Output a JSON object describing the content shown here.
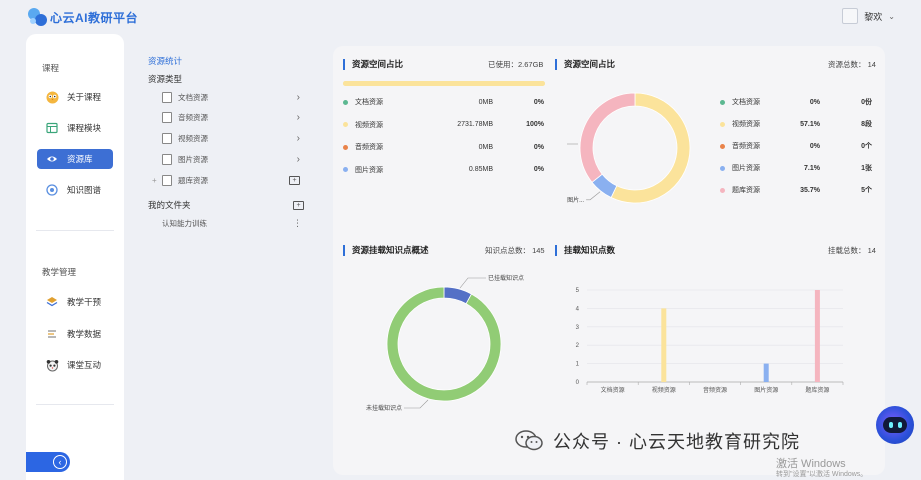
{
  "app": {
    "title": "心云AI教研平台"
  },
  "user": {
    "name": "黎欢"
  },
  "sidebar": {
    "section1": "课程",
    "items1": [
      {
        "label": "关于课程",
        "icon": "owl-icon"
      },
      {
        "label": "课程模块",
        "icon": "grid-icon"
      },
      {
        "label": "资源库",
        "icon": "eye-icon",
        "active": true
      },
      {
        "label": "知识图谱",
        "icon": "target-icon"
      }
    ],
    "section2": "教学管理",
    "items2": [
      {
        "label": "教学干预",
        "icon": "layers-icon"
      },
      {
        "label": "教学数据",
        "icon": "chart-icon"
      },
      {
        "label": "课堂互动",
        "icon": "panda-icon"
      }
    ]
  },
  "tree": {
    "stats_title": "资源统计",
    "types_title": "资源类型",
    "types": [
      "文档资源",
      "音频资源",
      "视频资源",
      "图片资源",
      "题库资源"
    ],
    "my_folders": "我的文件夹",
    "folders": [
      "认知能力训练"
    ]
  },
  "cards": {
    "space1": {
      "title": "资源空间占比",
      "meta": "已使用：2.67GB",
      "used_fraction": 1.0,
      "rows": [
        {
          "name": "文档资源",
          "size": "0MB",
          "pct": "0%",
          "color": "#5cb891"
        },
        {
          "name": "视频资源",
          "size": "2731.78MB",
          "pct": "100%",
          "color": "#fbe39b"
        },
        {
          "name": "音频资源",
          "size": "0MB",
          "pct": "0%",
          "color": "#e9834a"
        },
        {
          "name": "图片资源",
          "size": "0.85MB",
          "pct": "0%",
          "color": "#8ab0f0"
        }
      ]
    },
    "space2": {
      "title": "资源空间占比",
      "meta": "资源总数：  14",
      "callout": "图片...",
      "rows": [
        {
          "name": "文档资源",
          "pct": "0%",
          "count": "0份",
          "color": "#5cb891"
        },
        {
          "name": "视频资源",
          "pct": "57.1%",
          "count": "8段",
          "color": "#fbe39b"
        },
        {
          "name": "音频资源",
          "pct": "0%",
          "count": "0个",
          "color": "#e9834a"
        },
        {
          "name": "图片资源",
          "pct": "7.1%",
          "count": "1张",
          "color": "#8ab0f0"
        },
        {
          "name": "题库资源",
          "pct": "35.7%",
          "count": "5个",
          "color": "#f5b5bf"
        }
      ]
    },
    "knowledge": {
      "title": "资源挂载知识点概述",
      "meta": "知识点总数：  145",
      "labels": {
        "mounted": "已挂载知识点",
        "unmounted": "未挂载知识点"
      }
    },
    "mounted": {
      "title": "挂载知识点数",
      "meta": "挂载总数：  14"
    }
  },
  "chart_data": [
    {
      "type": "pie",
      "labels": [
        "文档资源",
        "视频资源",
        "音频资源",
        "图片资源",
        "题库资源"
      ],
      "values": [
        0,
        57.1,
        0,
        7.1,
        35.7
      ],
      "colors": [
        "#5cb891",
        "#fbe39b",
        "#e9834a",
        "#8ab0f0",
        "#f5b5bf"
      ]
    },
    {
      "type": "pie",
      "labels": [
        "已挂载知识点",
        "未挂载知识点"
      ],
      "values": [
        8,
        92
      ],
      "colors": [
        "#5470c6",
        "#91cc75"
      ]
    },
    {
      "type": "bar",
      "categories": [
        "文档资源",
        "视频资源",
        "音频资源",
        "图片资源",
        "题库资源"
      ],
      "values": [
        0,
        4,
        0,
        1,
        5
      ],
      "colors": [
        "#5cb891",
        "#fbe39b",
        "#e9834a",
        "#8ab0f0",
        "#f5b5bf"
      ],
      "ylim": [
        0,
        5
      ],
      "yticks": [
        "0",
        "1",
        "2",
        "3",
        "4",
        "5"
      ]
    }
  ],
  "watermark": {
    "text": "公众号 · 心云天地教育研究院",
    "win1": "激活 Windows",
    "win2": "转到\"设置\"以激活 Windows。"
  }
}
